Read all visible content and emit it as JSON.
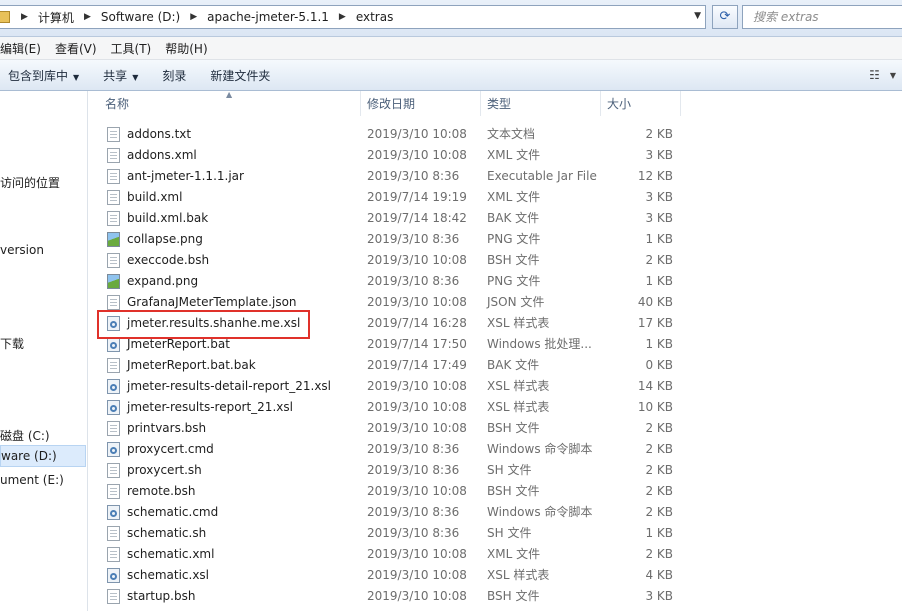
{
  "address_bar": {
    "crumbs": [
      "计算机",
      "Software (D:)",
      "apache-jmeter-5.1.1",
      "extras"
    ],
    "search_placeholder": "搜索 extras"
  },
  "menu": [
    "编辑(E)",
    "查看(V)",
    "工具(T)",
    "帮助(H)"
  ],
  "toolbar": {
    "include_library": "包含到库中",
    "share": "共享",
    "burn": "刻录",
    "new_folder": "新建文件夹"
  },
  "nav": {
    "recent_places": "访问的位置",
    "version": "version",
    "downloads": "下载",
    "drive_c": "磁盘 (C:)",
    "drive_d": "ware (D:)",
    "drive_e": "ument (E:)"
  },
  "columns": {
    "name": "名称",
    "date": "修改日期",
    "type": "类型",
    "size": "大小"
  },
  "files": [
    {
      "name": "addons.txt",
      "date": "2019/3/10 10:08",
      "type": "文本文档",
      "size": "2 KB",
      "icon": "text-file-icon"
    },
    {
      "name": "addons.xml",
      "date": "2019/3/10 10:08",
      "type": "XML 文件",
      "size": "3 KB",
      "icon": "xml-file-icon"
    },
    {
      "name": "ant-jmeter-1.1.1.jar",
      "date": "2019/3/10 8:36",
      "type": "Executable Jar File",
      "size": "12 KB",
      "icon": "jar-file-icon"
    },
    {
      "name": "build.xml",
      "date": "2019/7/14 19:19",
      "type": "XML 文件",
      "size": "3 KB",
      "icon": "xml-file-icon"
    },
    {
      "name": "build.xml.bak",
      "date": "2019/7/14 18:42",
      "type": "BAK 文件",
      "size": "3 KB",
      "icon": "bak-file-icon"
    },
    {
      "name": "collapse.png",
      "date": "2019/3/10 8:36",
      "type": "PNG 文件",
      "size": "1 KB",
      "icon": "png-image-icon"
    },
    {
      "name": "execcode.bsh",
      "date": "2019/3/10 10:08",
      "type": "BSH 文件",
      "size": "2 KB",
      "icon": "bsh-file-icon"
    },
    {
      "name": "expand.png",
      "date": "2019/3/10 8:36",
      "type": "PNG 文件",
      "size": "1 KB",
      "icon": "png-image-icon"
    },
    {
      "name": "GrafanaJMeterTemplate.json",
      "date": "2019/3/10 10:08",
      "type": "JSON 文件",
      "size": "40 KB",
      "icon": "json-file-icon"
    },
    {
      "name": "jmeter.results.shanhe.me.xsl",
      "date": "2019/7/14 16:28",
      "type": "XSL 样式表",
      "size": "17 KB",
      "icon": "xsl-file-icon"
    },
    {
      "name": "JmeterReport.bat",
      "date": "2019/7/14 17:50",
      "type": "Windows 批处理...",
      "size": "1 KB",
      "icon": "bat-file-icon"
    },
    {
      "name": "JmeterReport.bat.bak",
      "date": "2019/7/14 17:49",
      "type": "BAK 文件",
      "size": "0 KB",
      "icon": "bak-file-icon"
    },
    {
      "name": "jmeter-results-detail-report_21.xsl",
      "date": "2019/3/10 10:08",
      "type": "XSL 样式表",
      "size": "14 KB",
      "icon": "xsl-file-icon"
    },
    {
      "name": "jmeter-results-report_21.xsl",
      "date": "2019/3/10 10:08",
      "type": "XSL 样式表",
      "size": "10 KB",
      "icon": "xsl-file-icon"
    },
    {
      "name": "printvars.bsh",
      "date": "2019/3/10 10:08",
      "type": "BSH 文件",
      "size": "2 KB",
      "icon": "bsh-file-icon"
    },
    {
      "name": "proxycert.cmd",
      "date": "2019/3/10 8:36",
      "type": "Windows 命令脚本",
      "size": "2 KB",
      "icon": "cmd-file-icon"
    },
    {
      "name": "proxycert.sh",
      "date": "2019/3/10 8:36",
      "type": "SH 文件",
      "size": "2 KB",
      "icon": "sh-file-icon"
    },
    {
      "name": "remote.bsh",
      "date": "2019/3/10 10:08",
      "type": "BSH 文件",
      "size": "2 KB",
      "icon": "bsh-file-icon"
    },
    {
      "name": "schematic.cmd",
      "date": "2019/3/10 8:36",
      "type": "Windows 命令脚本",
      "size": "2 KB",
      "icon": "cmd-file-icon"
    },
    {
      "name": "schematic.sh",
      "date": "2019/3/10 8:36",
      "type": "SH 文件",
      "size": "1 KB",
      "icon": "sh-file-icon"
    },
    {
      "name": "schematic.xml",
      "date": "2019/3/10 10:08",
      "type": "XML 文件",
      "size": "2 KB",
      "icon": "xml-file-icon"
    },
    {
      "name": "schematic.xsl",
      "date": "2019/3/10 10:08",
      "type": "XSL 样式表",
      "size": "4 KB",
      "icon": "xsl-file-icon"
    },
    {
      "name": "startup.bsh",
      "date": "2019/3/10 10:08",
      "type": "BSH 文件",
      "size": "3 KB",
      "icon": "bsh-file-icon"
    }
  ],
  "colors": {
    "highlight": "#e0312a",
    "selected_nav": "#dcebfc"
  }
}
